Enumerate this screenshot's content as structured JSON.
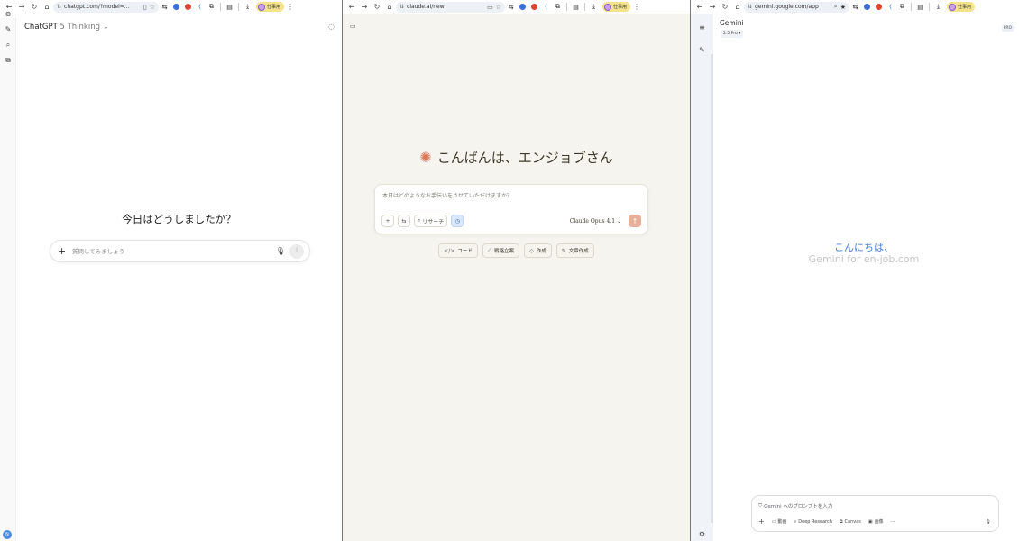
{
  "windows": {
    "chatgpt": {
      "browser": {
        "url": "chatgpt.com/?model=...",
        "profile": "仕事用"
      },
      "brand": "ChatGPT",
      "mode": "5 Thinking",
      "greeting": "今日はどうしましたか？",
      "input_placeholder": "質問してみましょう",
      "avatar_initial": "N"
    },
    "claude": {
      "browser": {
        "url": "claude.ai/new",
        "profile": "仕事用"
      },
      "greeting": "こんばんは、エンジョブさん",
      "input_placeholder": "本日はどのようなお手伝いをさせていただけますか？",
      "research_label": "リサーチ",
      "model": "Claude Opus 4.1",
      "chips": [
        {
          "icon": "code-icon",
          "label": "コード"
        },
        {
          "icon": "chart-icon",
          "label": "戦略立案"
        },
        {
          "icon": "tag-icon",
          "label": "作成"
        },
        {
          "icon": "pen-icon",
          "label": "文章作成"
        }
      ]
    },
    "gemini": {
      "browser": {
        "url": "gemini.google.com/app",
        "profile": "仕事用"
      },
      "title": "Gemini",
      "model": "2.5 Pro",
      "pro_badge": "PRO",
      "hello": "こんにちは、",
      "hello_sub": "Gemini for en-job.com",
      "input_placeholder": "Gemini へのプロンプトを入力",
      "tools": [
        {
          "icon": "video-icon",
          "label": "動画"
        },
        {
          "icon": "deep-research-icon",
          "label": "Deep Research"
        },
        {
          "icon": "canvas-icon",
          "label": "Canvas"
        },
        {
          "icon": "image-icon",
          "label": "画像"
        }
      ]
    }
  },
  "colors": {
    "claude_bg": "#f5f4ef",
    "claude_accent": "#d97757",
    "gemini_blue": "#4a7ed9",
    "profile_chip": "#f4e28c"
  }
}
